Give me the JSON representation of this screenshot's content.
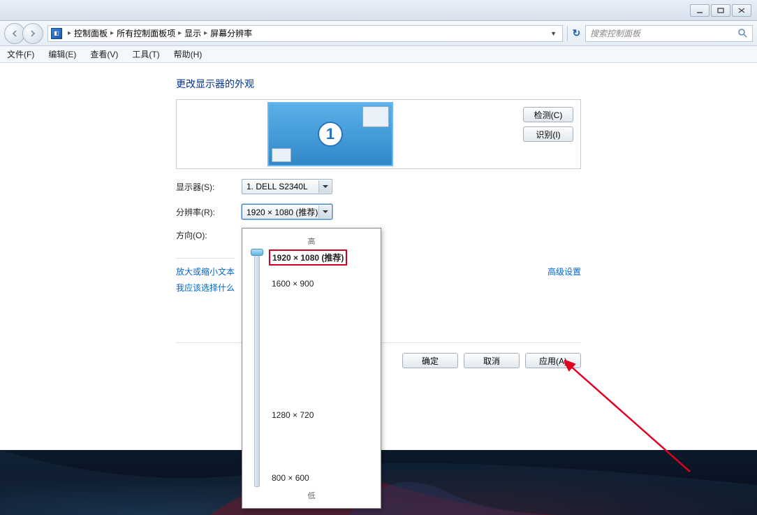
{
  "breadcrumb": {
    "items": [
      "控制面板",
      "所有控制面板项",
      "显示",
      "屏幕分辨率"
    ]
  },
  "search": {
    "placeholder": "搜索控制面板"
  },
  "menus": {
    "file": "文件(F)",
    "edit": "编辑(E)",
    "view": "查看(V)",
    "tools": "工具(T)",
    "help": "帮助(H)"
  },
  "page": {
    "title": "更改显示器的外观",
    "monitor_number": "1",
    "detect_btn": "检测(C)",
    "identify_btn": "识别(I)",
    "display_label": "显示器(S):",
    "display_value": "1. DELL S2340L",
    "resolution_label": "分辨率(R):",
    "resolution_value": "1920 × 1080 (推荐)",
    "orientation_label": "方向(O):",
    "advanced_link": "高级设置",
    "link1": "放大或缩小文本",
    "link2": "我应该选择什么",
    "ok": "确定",
    "cancel": "取消",
    "apply": "应用(A)"
  },
  "slider": {
    "high": "高",
    "low": "低",
    "options": [
      {
        "label": "1920 × 1080 (推荐)",
        "pos": 0,
        "selected": true
      },
      {
        "label": "1600 × 900",
        "pos": 42
      },
      {
        "label": "1280 × 720",
        "pos": 230
      },
      {
        "label": "800 × 600",
        "pos": 320
      }
    ]
  }
}
